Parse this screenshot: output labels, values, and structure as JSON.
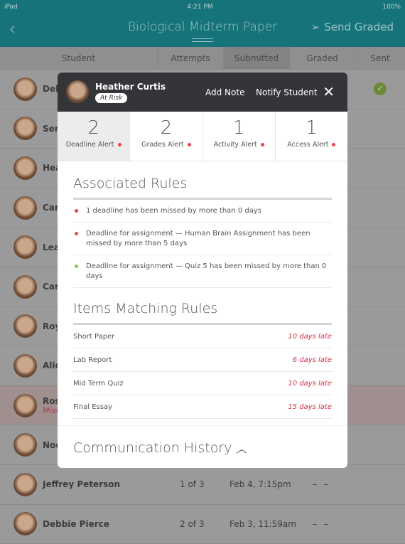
{
  "status": {
    "device": "iPad",
    "time": "4:21 PM",
    "battery": "100%"
  },
  "nav": {
    "title": "Biological Midterm Paper",
    "send": "Send Graded"
  },
  "columns": [
    "Student",
    "Attempts",
    "Submitted",
    "Graded",
    "Sent"
  ],
  "rows": [
    {
      "name": "Deb",
      "sent": "check"
    },
    {
      "name": "Serg"
    },
    {
      "name": "Hea"
    },
    {
      "name": "Can"
    },
    {
      "name": "Leal"
    },
    {
      "name": "Carl"
    },
    {
      "name": "Roy"
    },
    {
      "name": "Alici"
    },
    {
      "name": "Ros",
      "sub": "Miss",
      "risk": true
    },
    {
      "name": "Noe"
    },
    {
      "name": "Jeffrey Peterson",
      "attempts": "1 of 3",
      "submitted": "Feb 4, 7:15pm",
      "graded": "– –"
    },
    {
      "name": "Debbie Pierce",
      "attempts": "2 of 3",
      "submitted": "Feb 3, 11:59am",
      "graded": "– –"
    }
  ],
  "modal": {
    "student": "Heather Curtis",
    "badge": "At Risk",
    "add_note": "Add Note",
    "notify": "Notify Student",
    "stats": [
      {
        "n": "2",
        "label": "Deadline Alert"
      },
      {
        "n": "2",
        "label": "Grades Alert"
      },
      {
        "n": "1",
        "label": "Activity Alert"
      },
      {
        "n": "1",
        "label": "Access Alert"
      }
    ],
    "rules_title": "Associated Rules",
    "rules": [
      {
        "text": "1 deadline has been missed by more than 0 days",
        "color": "#e9424f"
      },
      {
        "text": "Deadline for assignment — Human Brain Assignment has been missed by more than 5 days",
        "color": "#e9424f"
      },
      {
        "text": "Deadline for assignment — Quiz 5 has been missed by more than 0 days",
        "color": "#8cc63f"
      }
    ],
    "items_title": "Items Matching Rules",
    "items": [
      {
        "name": "Short Paper",
        "late": "10 days late"
      },
      {
        "name": "Lab Report",
        "late": "6 days late"
      },
      {
        "name": "Mid Term Quiz",
        "late": "10 days late"
      },
      {
        "name": "Final Essay",
        "late": "15 days late"
      }
    ],
    "comm": "Communication History"
  }
}
